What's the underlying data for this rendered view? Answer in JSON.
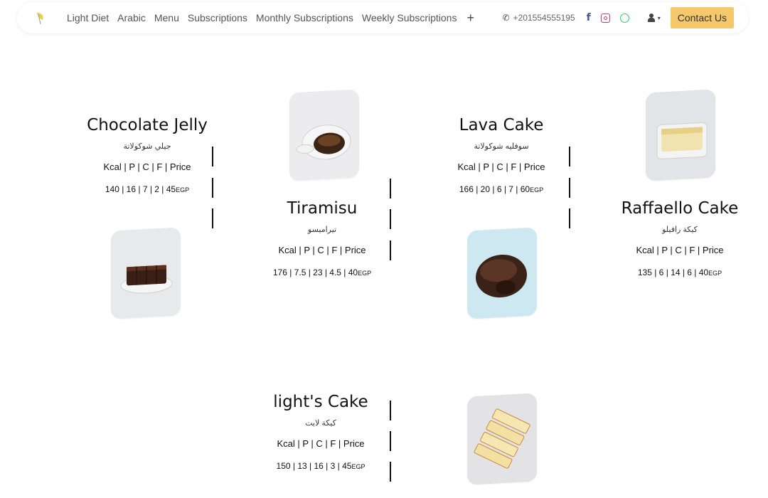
{
  "navbar": {
    "links": [
      "Light Diet",
      "Arabic",
      "Menu",
      "Subscriptions",
      "Monthly Subscriptions",
      "Weekly Subscriptions"
    ],
    "more_symbol": "+",
    "phone": "+201554555195",
    "contact_label": "Contact Us",
    "icons": {
      "logo": "leaf-logo-icon",
      "phone": "phone-icon",
      "facebook": "facebook-icon",
      "instagram": "instagram-icon",
      "whatsapp": "whatsapp-icon",
      "user": "user-icon"
    }
  },
  "colors": {
    "accent": "#f5c96b",
    "facebook": "#3b5998",
    "instagram": "#e1306c",
    "whatsapp": "#25d366"
  },
  "products": [
    {
      "name": "Chocolate Jelly",
      "arabic": "جيلي شوكولاتة",
      "header": "Kcal | P | C | F | Price",
      "values": "140 | 16 | 7 | 2 | 45",
      "currency": "EGP"
    },
    {
      "name": "Tiramisu",
      "arabic": "تيراميسو",
      "header": "Kcal | P | C | F | Price",
      "values": "176 | 7.5 | 23 | 4.5 | 40",
      "currency": "EGP"
    },
    {
      "name": "Lava Cake",
      "arabic": "سوفليه شوكولاتة",
      "header": "Kcal | P | C | F | Price",
      "values": "166 | 20 | 6 | 7 | 60",
      "currency": "EGP"
    },
    {
      "name": "Raffaello Cake",
      "arabic": "كيكة رافيلو",
      "header": "Kcal | P | C | F | Price",
      "values": "135 | 6 | 14 | 6 | 40",
      "currency": "EGP"
    },
    {
      "name": "light's Cake",
      "arabic": "كيكة لايت",
      "header": "Kcal | P | C | F | Price",
      "values": "150 | 13 | 16 | 3 | 45",
      "currency": "EGP"
    }
  ]
}
